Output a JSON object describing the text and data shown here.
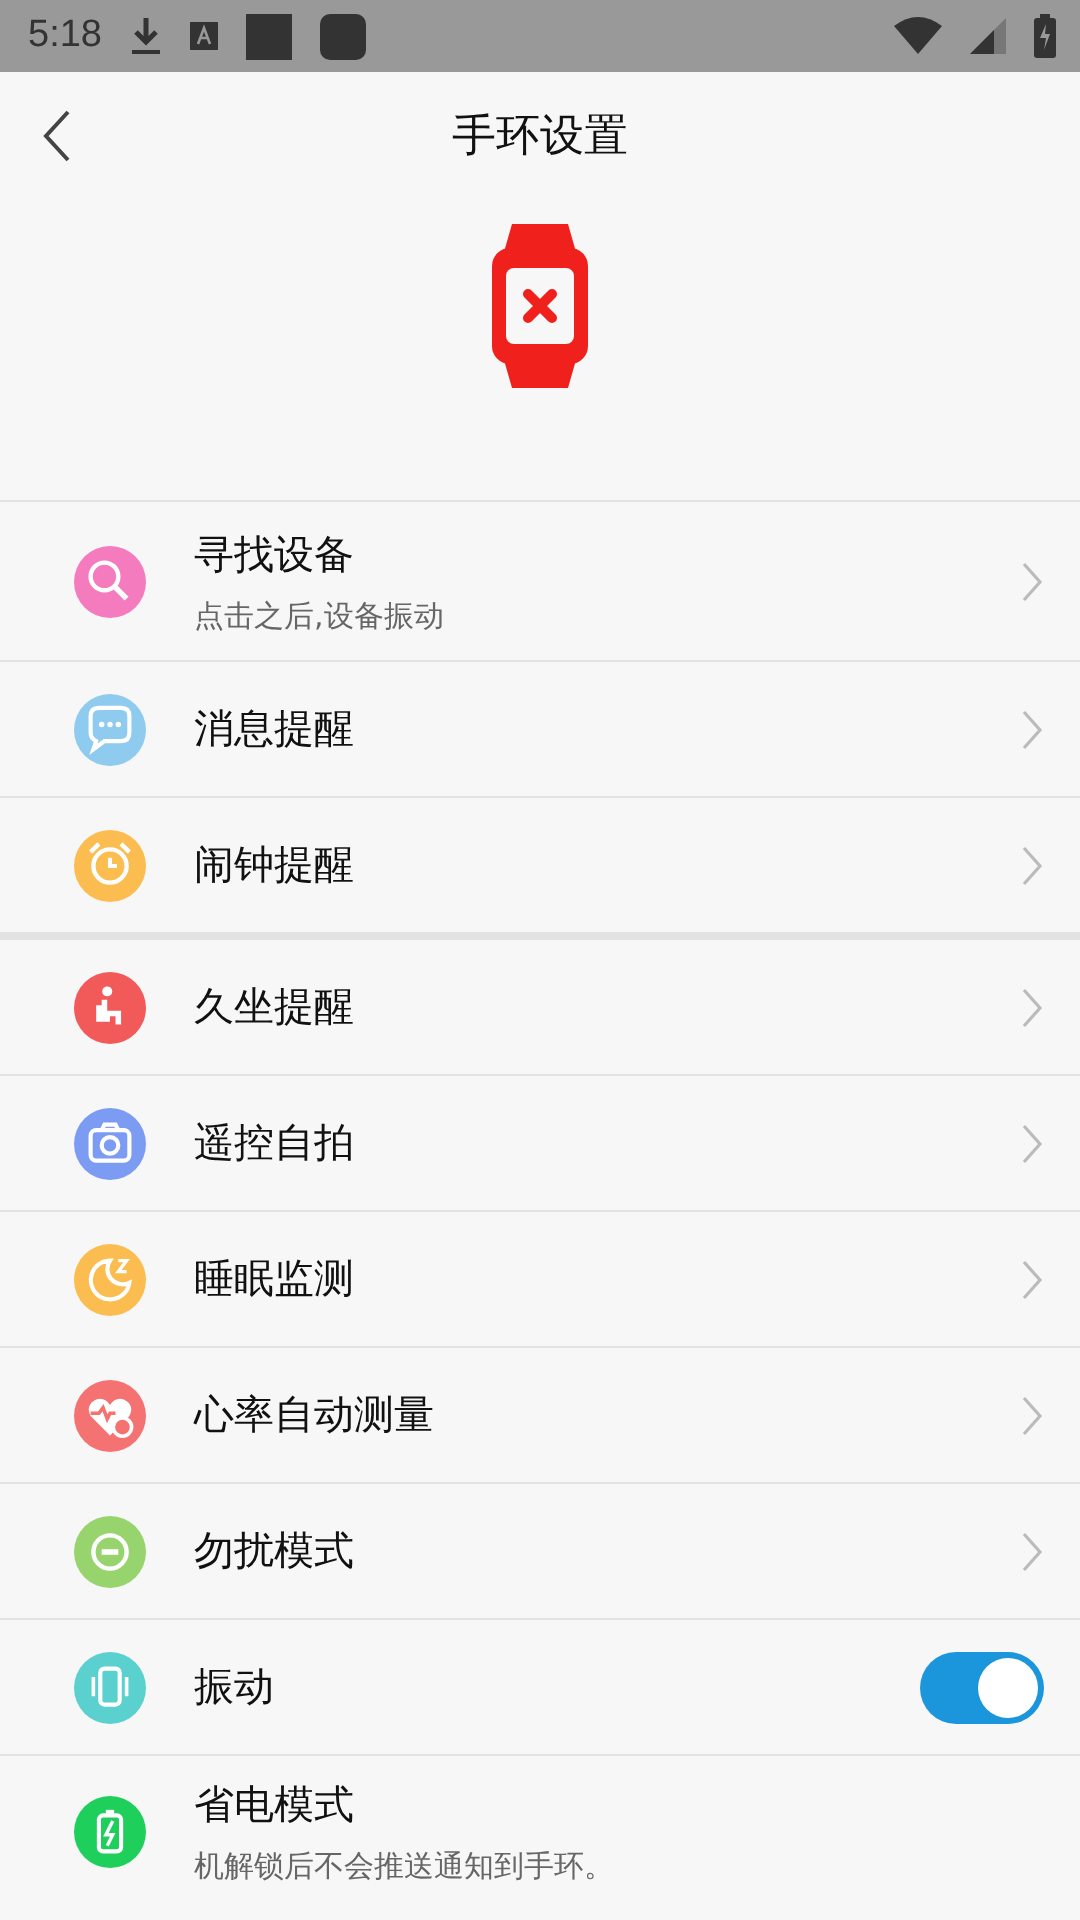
{
  "status_bar": {
    "time": "5:18"
  },
  "header": {
    "title": "手环设置"
  },
  "sections": [
    {
      "items": [
        {
          "kind": "nav",
          "label": "寻找设备",
          "subtitle": "点击之后,设备振动"
        },
        {
          "kind": "nav",
          "label": "消息提醒"
        },
        {
          "kind": "nav",
          "label": "闹钟提醒"
        }
      ]
    },
    {
      "items": [
        {
          "kind": "nav",
          "label": "久坐提醒"
        },
        {
          "kind": "nav",
          "label": "遥控自拍"
        },
        {
          "kind": "nav",
          "label": "睡眠监测"
        },
        {
          "kind": "nav",
          "label": "心率自动测量"
        },
        {
          "kind": "nav",
          "label": "勿扰模式"
        },
        {
          "kind": "toggle",
          "label": "振动",
          "on": true
        },
        {
          "kind": "plain",
          "label": "省电模式",
          "subtitle": "机解锁后不会推送通知到手环。"
        }
      ]
    }
  ]
}
